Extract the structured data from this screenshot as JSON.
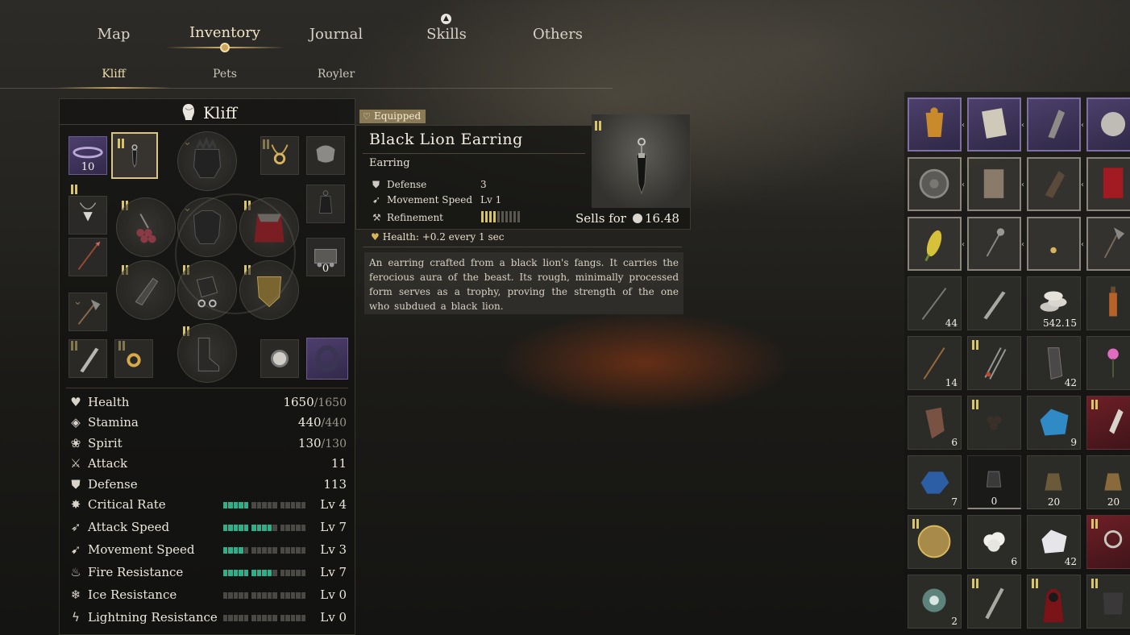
{
  "nav": {
    "tabs": [
      {
        "label": "Map"
      },
      {
        "label": "Inventory"
      },
      {
        "label": "Journal"
      },
      {
        "label": "Skills"
      },
      {
        "label": "Others"
      }
    ],
    "active": "Inventory"
  },
  "subnav": {
    "tabs": [
      {
        "label": "Kliff"
      },
      {
        "label": "Pets"
      },
      {
        "label": "Royler"
      }
    ],
    "active": "Kliff"
  },
  "character": {
    "name": "Kliff",
    "slot_counts": {
      "headband": "10",
      "mount_item": "0"
    }
  },
  "stats": {
    "health": {
      "label": "Health",
      "value": "1650",
      "max": "/1650"
    },
    "stamina": {
      "label": "Stamina",
      "value": "440",
      "max": "/440"
    },
    "spirit": {
      "label": "Spirit",
      "value": "130",
      "max": "/130"
    },
    "attack": {
      "label": "Attack",
      "value": "11"
    },
    "defense": {
      "label": "Defense",
      "value": "113"
    },
    "critical_rate": {
      "label": "Critical Rate",
      "level": "Lv 4",
      "fill": 4
    },
    "attack_speed": {
      "label": "Attack Speed",
      "level": "Lv 7",
      "fill": 7
    },
    "movement_speed": {
      "label": "Movement Speed",
      "level": "Lv 3",
      "fill": 3
    },
    "fire_resistance": {
      "label": "Fire Resistance",
      "level": "Lv 7",
      "fill": 7
    },
    "ice_resistance": {
      "label": "Ice Resistance",
      "level": "Lv 0",
      "fill": 0
    },
    "lightning_resistance": {
      "label": "Lightning Resistance",
      "level": "Lv 0",
      "fill": 0
    }
  },
  "tooltip": {
    "badge": "Equipped",
    "name": "Black Lion Earring",
    "type": "Earring",
    "defense_label": "Defense",
    "defense_value": "3",
    "movement_label": "Movement Speed",
    "movement_value": "Lv 1",
    "refinement_label": "Refinement",
    "refinement_level": 4,
    "refinement_max": 10,
    "sells_label": "Sells for",
    "sells_value": "16.48",
    "effect": "Health: +0.2 every 1 sec",
    "description": "An earring crafted from a black lion's fangs. It carries the ferocious aura of the beast. Its rough, minimally processed form serves as a trophy, proving the strength of the one who subdued a black lion."
  },
  "inventory": {
    "counts": {
      "spear": "44",
      "coins": "542.15",
      "arrows": "14",
      "rope_bundle": "42",
      "hide": "6",
      "blue_crystal": "9",
      "blue_ore": "7",
      "lantern": "0",
      "bronze_bell_1": "20",
      "bronze_bell_2": "20",
      "cotton": "6",
      "salt": "42",
      "spirit_orb": "2"
    }
  },
  "colors": {
    "accent_gold": "#d8b56c",
    "tier_yellow": "#d8c46a",
    "stat_bar_green": "#2fae8a",
    "rare_purple": "#4d3f6e"
  }
}
